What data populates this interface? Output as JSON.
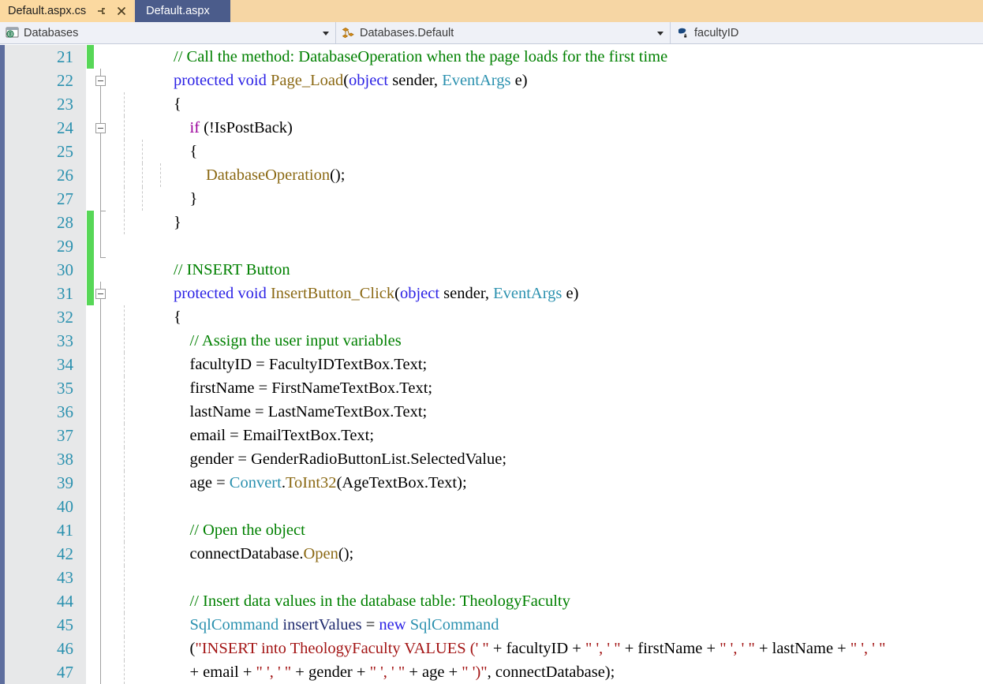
{
  "tabs": [
    {
      "label": "Default.aspx.cs",
      "state": "active",
      "pin_icon": "pin-icon",
      "close_icon": "close-icon"
    },
    {
      "label": "Default.aspx",
      "state": "inactive"
    }
  ],
  "navbar": {
    "project_dropdown": {
      "icon": "namespace-globe-icon",
      "value": "Databases"
    },
    "type_dropdown": {
      "icon": "class-icon",
      "value": "Databases.Default"
    },
    "member_dropdown": {
      "icon": "field-private-icon",
      "value": "facultyID"
    }
  },
  "editor": {
    "font": "serif",
    "colors": {
      "comment": "#008000",
      "keyword": "#2B21E5",
      "control_keyword": "#9B009B",
      "type": "#2B91AF",
      "method": "#8B6914",
      "string": "#A31515",
      "local_variable": "#1F2A6E",
      "line_number": "#2B91AF",
      "change_bar_added": "#57D757",
      "gutter_background": "#E7E8E9",
      "selection_strip": "#5E6E9E"
    },
    "first_visible_line": 21,
    "last_visible_line": 47,
    "lines": [
      {
        "n": 21,
        "change": "added",
        "fold": "none",
        "guides": 0,
        "tokens": [
          {
            "t": "                ",
            "c": "pl"
          },
          {
            "t": "// Call the method: DatabaseOperation when the page loads for the first time",
            "c": "cm"
          }
        ]
      },
      {
        "n": 22,
        "change": "none",
        "fold": "box",
        "guides": 0,
        "tokens": [
          {
            "t": "                ",
            "c": "pl"
          },
          {
            "t": "protected void ",
            "c": "kw"
          },
          {
            "t": "Page_Load",
            "c": "mth"
          },
          {
            "t": "(",
            "c": "pl"
          },
          {
            "t": "object",
            "c": "kw"
          },
          {
            "t": " sender, ",
            "c": "pl"
          },
          {
            "t": "EventArgs",
            "c": "ty"
          },
          {
            "t": " e)",
            "c": "pl"
          }
        ]
      },
      {
        "n": 23,
        "change": "none",
        "fold": "line",
        "guides": 1,
        "tokens": [
          {
            "t": "                {",
            "c": "pl"
          }
        ]
      },
      {
        "n": 24,
        "change": "none",
        "fold": "box",
        "guides": 1,
        "tokens": [
          {
            "t": "                    ",
            "c": "pl"
          },
          {
            "t": "if",
            "c": "kwc"
          },
          {
            "t": " (!IsPostBack)",
            "c": "pl"
          }
        ]
      },
      {
        "n": 25,
        "change": "none",
        "fold": "line",
        "guides": 2,
        "tokens": [
          {
            "t": "                    {",
            "c": "pl"
          }
        ]
      },
      {
        "n": 26,
        "change": "none",
        "fold": "line",
        "guides": 3,
        "tokens": [
          {
            "t": "                        ",
            "c": "pl"
          },
          {
            "t": "DatabaseOperation",
            "c": "mth"
          },
          {
            "t": "();",
            "c": "pl"
          }
        ]
      },
      {
        "n": 27,
        "change": "none",
        "fold": "line",
        "guides": 2,
        "tokens": [
          {
            "t": "                    }",
            "c": "pl"
          }
        ]
      },
      {
        "n": 28,
        "change": "added",
        "fold": "endtop",
        "guides": 1,
        "tokens": [
          {
            "t": "                }",
            "c": "pl"
          }
        ]
      },
      {
        "n": 29,
        "change": "added",
        "fold": "endbot",
        "guides": 0,
        "tokens": [
          {
            "t": "",
            "c": "pl"
          }
        ]
      },
      {
        "n": 30,
        "change": "added",
        "fold": "none",
        "guides": 0,
        "tokens": [
          {
            "t": "                ",
            "c": "pl"
          },
          {
            "t": "// INSERT Button",
            "c": "cm"
          }
        ]
      },
      {
        "n": 31,
        "change": "added",
        "fold": "box",
        "guides": 0,
        "tokens": [
          {
            "t": "                ",
            "c": "pl"
          },
          {
            "t": "protected void ",
            "c": "kw"
          },
          {
            "t": "InsertButton_Click",
            "c": "mth"
          },
          {
            "t": "(",
            "c": "pl"
          },
          {
            "t": "object",
            "c": "kw"
          },
          {
            "t": " sender, ",
            "c": "pl"
          },
          {
            "t": "EventArgs",
            "c": "ty"
          },
          {
            "t": " e)",
            "c": "pl"
          }
        ]
      },
      {
        "n": 32,
        "change": "none",
        "fold": "line",
        "guides": 1,
        "tokens": [
          {
            "t": "                {",
            "c": "pl"
          }
        ]
      },
      {
        "n": 33,
        "change": "none",
        "fold": "line",
        "guides": 1,
        "tokens": [
          {
            "t": "                    ",
            "c": "pl"
          },
          {
            "t": "// Assign the user input variables",
            "c": "cm"
          }
        ]
      },
      {
        "n": 34,
        "change": "none",
        "fold": "line",
        "guides": 1,
        "tokens": [
          {
            "t": "                    facultyID = FacultyIDTextBox.Text;",
            "c": "pl"
          }
        ]
      },
      {
        "n": 35,
        "change": "none",
        "fold": "line",
        "guides": 1,
        "tokens": [
          {
            "t": "                    firstName = FirstNameTextBox.Text;",
            "c": "pl"
          }
        ]
      },
      {
        "n": 36,
        "change": "none",
        "fold": "line",
        "guides": 1,
        "tokens": [
          {
            "t": "                    lastName = LastNameTextBox.Text;",
            "c": "pl"
          }
        ]
      },
      {
        "n": 37,
        "change": "none",
        "fold": "line",
        "guides": 1,
        "tokens": [
          {
            "t": "                    email = EmailTextBox.Text;",
            "c": "pl"
          }
        ]
      },
      {
        "n": 38,
        "change": "none",
        "fold": "line",
        "guides": 1,
        "tokens": [
          {
            "t": "                    gender = GenderRadioButtonList.SelectedValue;",
            "c": "pl"
          }
        ]
      },
      {
        "n": 39,
        "change": "none",
        "fold": "line",
        "guides": 1,
        "tokens": [
          {
            "t": "                    age = ",
            "c": "pl"
          },
          {
            "t": "Convert",
            "c": "ty"
          },
          {
            "t": ".",
            "c": "pl"
          },
          {
            "t": "ToInt32",
            "c": "mth"
          },
          {
            "t": "(AgeTextBox.Text);",
            "c": "pl"
          }
        ]
      },
      {
        "n": 40,
        "change": "none",
        "fold": "line",
        "guides": 1,
        "tokens": [
          {
            "t": "",
            "c": "pl"
          }
        ]
      },
      {
        "n": 41,
        "change": "none",
        "fold": "line",
        "guides": 1,
        "tokens": [
          {
            "t": "                    ",
            "c": "pl"
          },
          {
            "t": "// Open the object",
            "c": "cm"
          }
        ]
      },
      {
        "n": 42,
        "change": "none",
        "fold": "line",
        "guides": 1,
        "tokens": [
          {
            "t": "                    connectDatabase.",
            "c": "pl"
          },
          {
            "t": "Open",
            "c": "mth"
          },
          {
            "t": "();",
            "c": "pl"
          }
        ]
      },
      {
        "n": 43,
        "change": "none",
        "fold": "line",
        "guides": 1,
        "tokens": [
          {
            "t": "",
            "c": "pl"
          }
        ]
      },
      {
        "n": 44,
        "change": "none",
        "fold": "line",
        "guides": 1,
        "tokens": [
          {
            "t": "                    ",
            "c": "pl"
          },
          {
            "t": "// Insert data values in the database table: TheologyFaculty",
            "c": "cm"
          }
        ]
      },
      {
        "n": 45,
        "change": "none",
        "fold": "line",
        "guides": 1,
        "tokens": [
          {
            "t": "                    ",
            "c": "pl"
          },
          {
            "t": "SqlCommand",
            "c": "ty"
          },
          {
            "t": " ",
            "c": "pl"
          },
          {
            "t": "insertValues",
            "c": "nv"
          },
          {
            "t": " = ",
            "c": "pl"
          },
          {
            "t": "new",
            "c": "kw"
          },
          {
            "t": " ",
            "c": "pl"
          },
          {
            "t": "SqlCommand",
            "c": "ty"
          }
        ]
      },
      {
        "n": 46,
        "change": "none",
        "fold": "line",
        "guides": 1,
        "tokens": [
          {
            "t": "                    (",
            "c": "pl"
          },
          {
            "t": "\"INSERT into TheologyFaculty VALUES (' \"",
            "c": "st"
          },
          {
            "t": " + facultyID + ",
            "c": "pl"
          },
          {
            "t": "\" ', ' \"",
            "c": "st"
          },
          {
            "t": " + firstName + ",
            "c": "pl"
          },
          {
            "t": "\" ', ' \"",
            "c": "st"
          },
          {
            "t": " + lastName + ",
            "c": "pl"
          },
          {
            "t": "\" ', ' \"",
            "c": "st"
          }
        ]
      },
      {
        "n": 47,
        "change": "none",
        "fold": "line",
        "guides": 1,
        "tokens": [
          {
            "t": "                    + email + ",
            "c": "pl"
          },
          {
            "t": "\" ', ' \"",
            "c": "st"
          },
          {
            "t": " + gender + ",
            "c": "pl"
          },
          {
            "t": "\" ', ' \"",
            "c": "st"
          },
          {
            "t": " + age + ",
            "c": "pl"
          },
          {
            "t": "\" ')\"",
            "c": "st"
          },
          {
            "t": ", connectDatabase);",
            "c": "pl"
          }
        ]
      }
    ]
  }
}
